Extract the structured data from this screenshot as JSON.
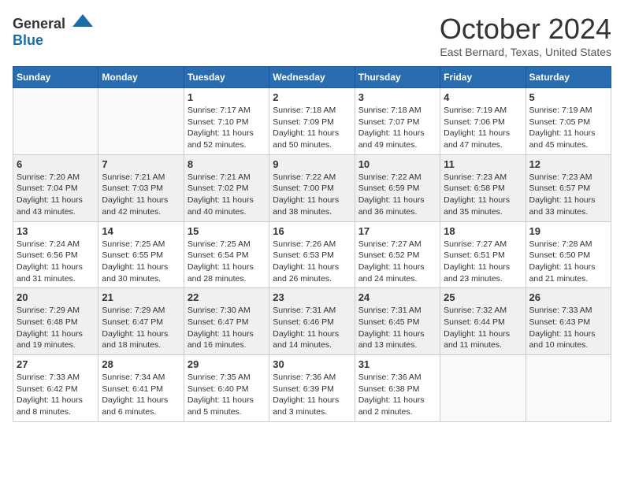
{
  "header": {
    "logo_general": "General",
    "logo_blue": "Blue",
    "month_title": "October 2024",
    "location": "East Bernard, Texas, United States"
  },
  "days_of_week": [
    "Sunday",
    "Monday",
    "Tuesday",
    "Wednesday",
    "Thursday",
    "Friday",
    "Saturday"
  ],
  "weeks": [
    [
      {
        "day": "",
        "info": ""
      },
      {
        "day": "",
        "info": ""
      },
      {
        "day": "1",
        "info": "Sunrise: 7:17 AM\nSunset: 7:10 PM\nDaylight: 11 hours and 52 minutes."
      },
      {
        "day": "2",
        "info": "Sunrise: 7:18 AM\nSunset: 7:09 PM\nDaylight: 11 hours and 50 minutes."
      },
      {
        "day": "3",
        "info": "Sunrise: 7:18 AM\nSunset: 7:07 PM\nDaylight: 11 hours and 49 minutes."
      },
      {
        "day": "4",
        "info": "Sunrise: 7:19 AM\nSunset: 7:06 PM\nDaylight: 11 hours and 47 minutes."
      },
      {
        "day": "5",
        "info": "Sunrise: 7:19 AM\nSunset: 7:05 PM\nDaylight: 11 hours and 45 minutes."
      }
    ],
    [
      {
        "day": "6",
        "info": "Sunrise: 7:20 AM\nSunset: 7:04 PM\nDaylight: 11 hours and 43 minutes."
      },
      {
        "day": "7",
        "info": "Sunrise: 7:21 AM\nSunset: 7:03 PM\nDaylight: 11 hours and 42 minutes."
      },
      {
        "day": "8",
        "info": "Sunrise: 7:21 AM\nSunset: 7:02 PM\nDaylight: 11 hours and 40 minutes."
      },
      {
        "day": "9",
        "info": "Sunrise: 7:22 AM\nSunset: 7:00 PM\nDaylight: 11 hours and 38 minutes."
      },
      {
        "day": "10",
        "info": "Sunrise: 7:22 AM\nSunset: 6:59 PM\nDaylight: 11 hours and 36 minutes."
      },
      {
        "day": "11",
        "info": "Sunrise: 7:23 AM\nSunset: 6:58 PM\nDaylight: 11 hours and 35 minutes."
      },
      {
        "day": "12",
        "info": "Sunrise: 7:23 AM\nSunset: 6:57 PM\nDaylight: 11 hours and 33 minutes."
      }
    ],
    [
      {
        "day": "13",
        "info": "Sunrise: 7:24 AM\nSunset: 6:56 PM\nDaylight: 11 hours and 31 minutes."
      },
      {
        "day": "14",
        "info": "Sunrise: 7:25 AM\nSunset: 6:55 PM\nDaylight: 11 hours and 30 minutes."
      },
      {
        "day": "15",
        "info": "Sunrise: 7:25 AM\nSunset: 6:54 PM\nDaylight: 11 hours and 28 minutes."
      },
      {
        "day": "16",
        "info": "Sunrise: 7:26 AM\nSunset: 6:53 PM\nDaylight: 11 hours and 26 minutes."
      },
      {
        "day": "17",
        "info": "Sunrise: 7:27 AM\nSunset: 6:52 PM\nDaylight: 11 hours and 24 minutes."
      },
      {
        "day": "18",
        "info": "Sunrise: 7:27 AM\nSunset: 6:51 PM\nDaylight: 11 hours and 23 minutes."
      },
      {
        "day": "19",
        "info": "Sunrise: 7:28 AM\nSunset: 6:50 PM\nDaylight: 11 hours and 21 minutes."
      }
    ],
    [
      {
        "day": "20",
        "info": "Sunrise: 7:29 AM\nSunset: 6:48 PM\nDaylight: 11 hours and 19 minutes."
      },
      {
        "day": "21",
        "info": "Sunrise: 7:29 AM\nSunset: 6:47 PM\nDaylight: 11 hours and 18 minutes."
      },
      {
        "day": "22",
        "info": "Sunrise: 7:30 AM\nSunset: 6:47 PM\nDaylight: 11 hours and 16 minutes."
      },
      {
        "day": "23",
        "info": "Sunrise: 7:31 AM\nSunset: 6:46 PM\nDaylight: 11 hours and 14 minutes."
      },
      {
        "day": "24",
        "info": "Sunrise: 7:31 AM\nSunset: 6:45 PM\nDaylight: 11 hours and 13 minutes."
      },
      {
        "day": "25",
        "info": "Sunrise: 7:32 AM\nSunset: 6:44 PM\nDaylight: 11 hours and 11 minutes."
      },
      {
        "day": "26",
        "info": "Sunrise: 7:33 AM\nSunset: 6:43 PM\nDaylight: 11 hours and 10 minutes."
      }
    ],
    [
      {
        "day": "27",
        "info": "Sunrise: 7:33 AM\nSunset: 6:42 PM\nDaylight: 11 hours and 8 minutes."
      },
      {
        "day": "28",
        "info": "Sunrise: 7:34 AM\nSunset: 6:41 PM\nDaylight: 11 hours and 6 minutes."
      },
      {
        "day": "29",
        "info": "Sunrise: 7:35 AM\nSunset: 6:40 PM\nDaylight: 11 hours and 5 minutes."
      },
      {
        "day": "30",
        "info": "Sunrise: 7:36 AM\nSunset: 6:39 PM\nDaylight: 11 hours and 3 minutes."
      },
      {
        "day": "31",
        "info": "Sunrise: 7:36 AM\nSunset: 6:38 PM\nDaylight: 11 hours and 2 minutes."
      },
      {
        "day": "",
        "info": ""
      },
      {
        "day": "",
        "info": ""
      }
    ]
  ]
}
